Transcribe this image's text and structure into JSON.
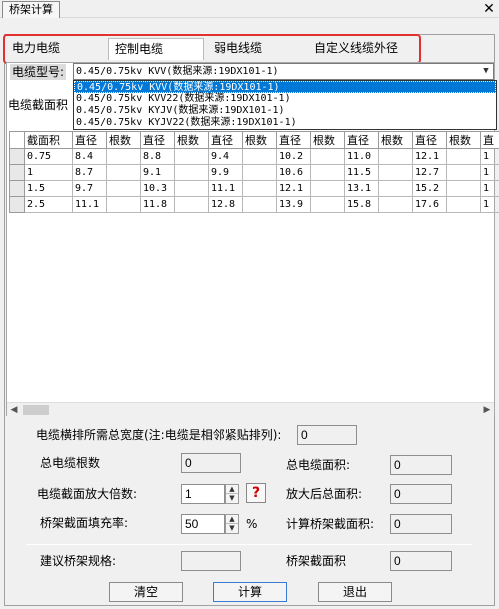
{
  "window": {
    "tab_title": "桥架计算",
    "close_glyph": "✕"
  },
  "tabs": [
    {
      "label": "电力电缆",
      "active": false
    },
    {
      "label": "控制电缆",
      "active": true
    },
    {
      "label": "弱电线缆",
      "active": false
    },
    {
      "label": "自定义线缆外径",
      "active": false
    }
  ],
  "cable_type": {
    "label": "电缆型号:",
    "selected": "0.45/0.75kv KVV(数据来源:19DX101-1)",
    "options": [
      "0.45/0.75kv KVV(数据来源:19DX101-1)",
      "0.45/0.75kv KVV22(数据来源:19DX101-1)",
      "0.45/0.75kv KYJV(数据来源:19DX101-1)",
      "0.45/0.75kv KYJV22(数据来源:19DX101-1)"
    ]
  },
  "section_label": "电缆截面积",
  "grid": {
    "headers": [
      "截面积",
      "直径",
      "根数",
      "直径",
      "根数",
      "直径",
      "根数",
      "直径",
      "根数",
      "直径",
      "根数",
      "直径",
      "根数",
      "直"
    ],
    "rows": [
      [
        "0.75",
        "8.4",
        "",
        "8.8",
        "",
        "9.4",
        "",
        "10.2",
        "",
        "11.0",
        "",
        "12.1",
        "",
        "1"
      ],
      [
        "1",
        "8.7",
        "",
        "9.1",
        "",
        "9.9",
        "",
        "10.6",
        "",
        "11.5",
        "",
        "12.7",
        "",
        "1"
      ],
      [
        "1.5",
        "9.7",
        "",
        "10.3",
        "",
        "11.1",
        "",
        "12.1",
        "",
        "13.1",
        "",
        "15.2",
        "",
        "1"
      ],
      [
        "2.5",
        "11.1",
        "",
        "11.8",
        "",
        "12.8",
        "",
        "13.9",
        "",
        "15.8",
        "",
        "17.6",
        "",
        "1"
      ]
    ]
  },
  "form": {
    "total_width_label": "电缆横排所需总宽度(注:电缆是相邻紧贴排列):",
    "total_width_value": "0",
    "total_count_label": "总电缆根数",
    "total_count_value": "0",
    "total_area_label": "总电缆面积:",
    "total_area_value": "0",
    "scale_label": "电缆截面放大倍数:",
    "scale_value": "1",
    "help_glyph": "?",
    "scaled_area_label": "放大后总面积:",
    "scaled_area_value": "0",
    "fill_rate_label": "桥架截面填充率:",
    "fill_rate_value": "50",
    "fill_rate_unit": "%",
    "calc_area_label": "计算桥架截面积:",
    "calc_area_value": "0",
    "suggest_spec_label": "建议桥架规格:",
    "suggest_spec_value": "",
    "tray_area_label": "桥架截面积",
    "tray_area_value": "0"
  },
  "buttons": {
    "clear": "清空",
    "calculate": "计算",
    "exit": "退出"
  }
}
